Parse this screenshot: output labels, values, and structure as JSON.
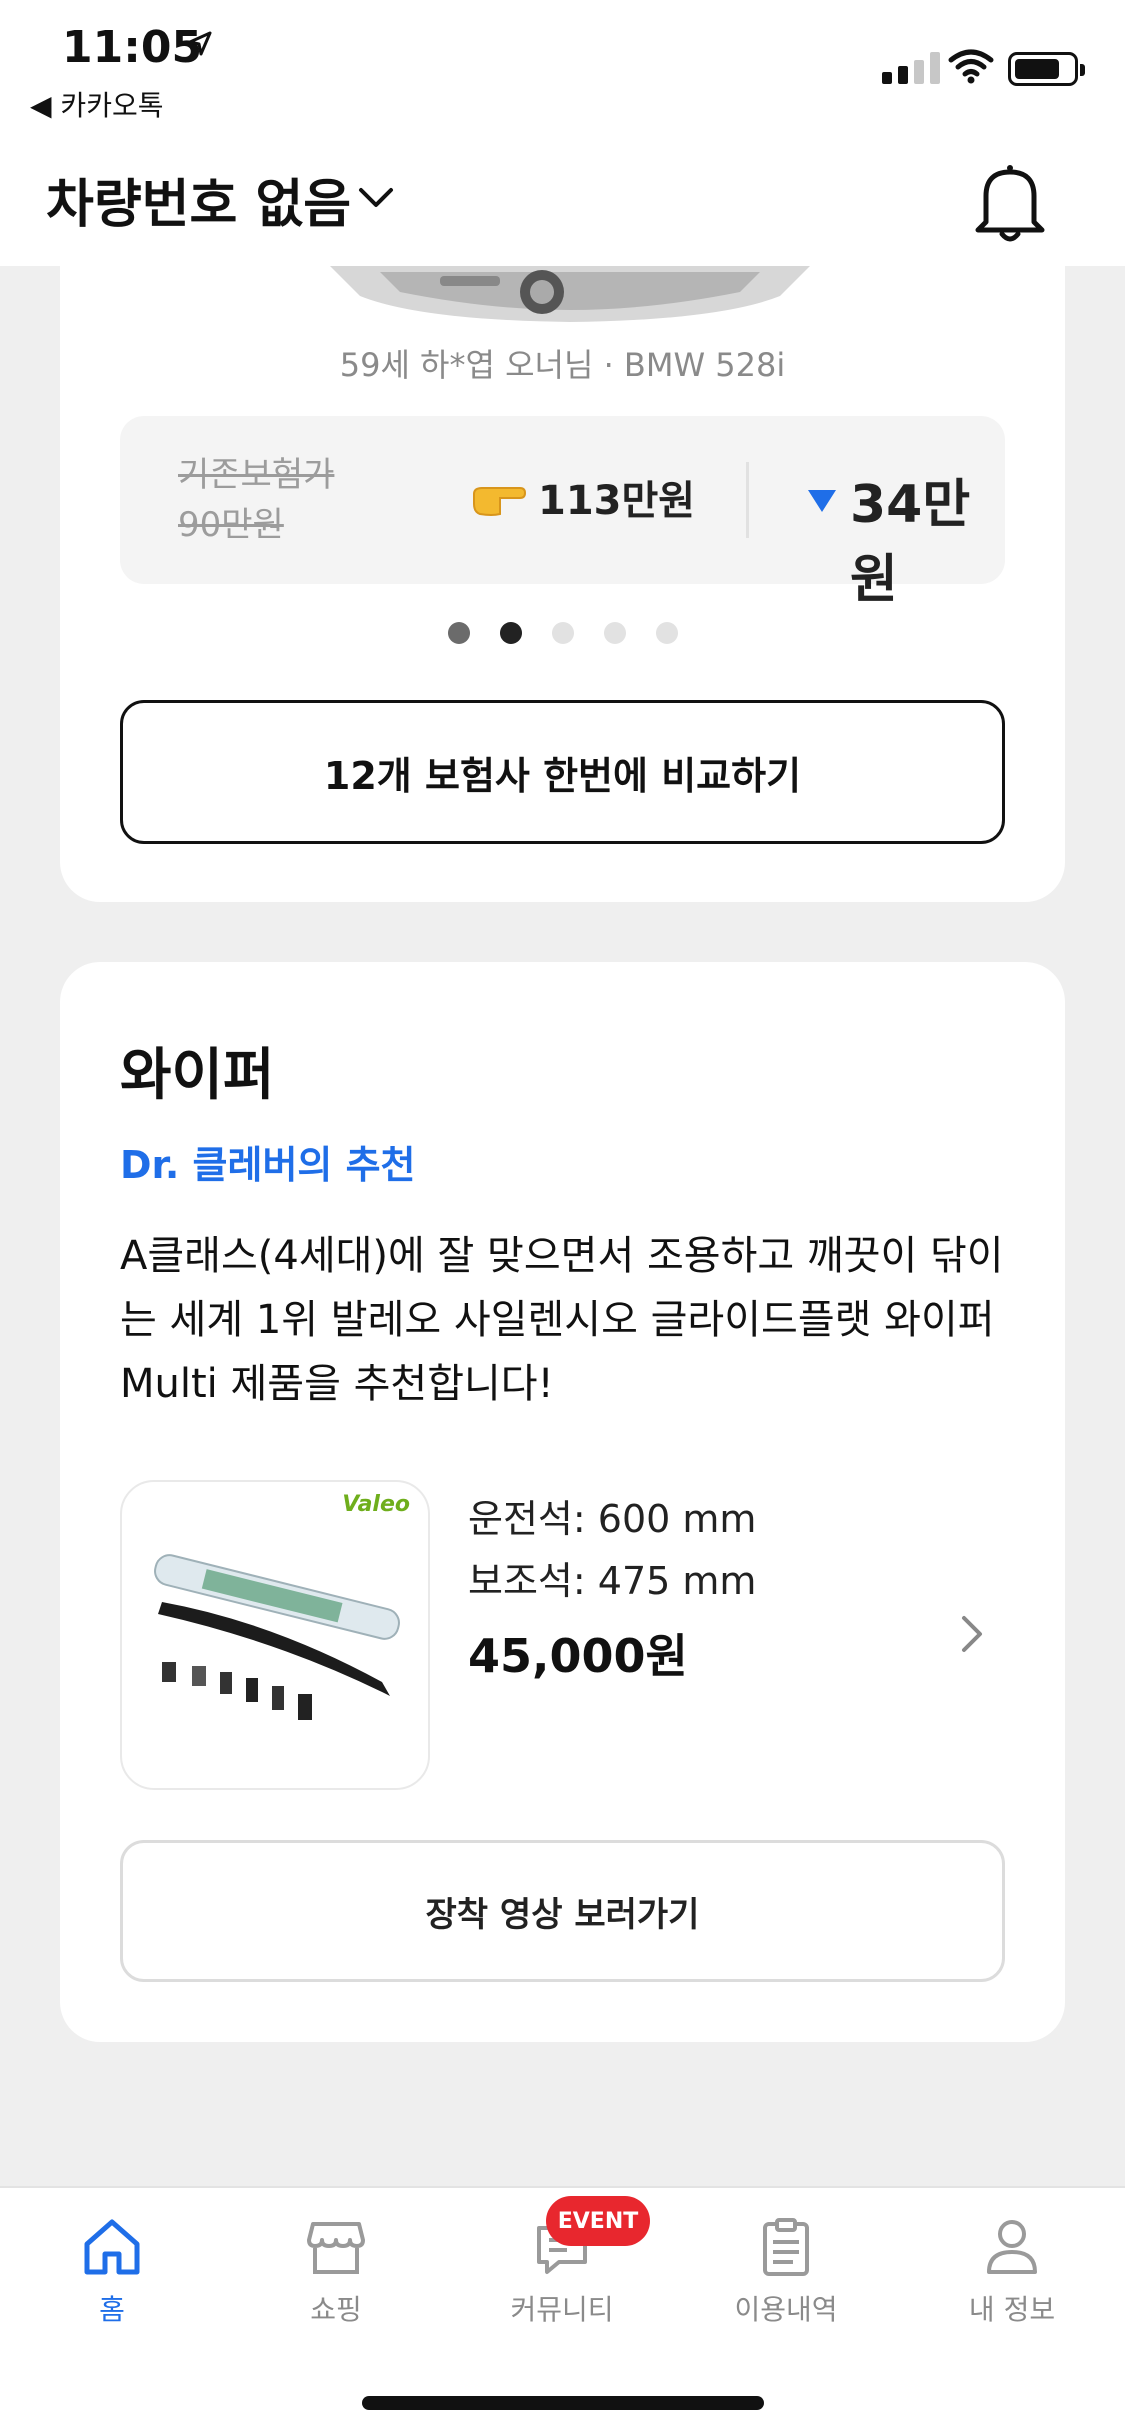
{
  "status_bar": {
    "time": "11:05",
    "back_app": "◀ 카카오톡"
  },
  "header": {
    "vehicle_title": "차량번호 없음"
  },
  "insurance_card": {
    "owner_caption": "59세 하*엽 오너님 · BMW 528i",
    "old_price": "기존보험가 90만원",
    "new_price": "113만원",
    "saving": "34만원",
    "carousel_pages": 5,
    "carousel_current": 2,
    "compare_button": "12개 보험사 한번에 비교하기"
  },
  "wiper_card": {
    "title": "와이퍼",
    "doctor_pick": "Dr. 클레버의 추천",
    "description": "A클래스(4세대)에 잘 맞으면서 조용하고 깨끗이 닦이는 세계 1위 발레오 사일렌시오 글라이드플랫 와이퍼 Multi 제품을 추천합니다!",
    "brand": "Valeo",
    "driver_spec": "운전석: 600 mm",
    "passenger_spec": "보조석: 475 mm",
    "price": "45,000원",
    "video_button": "장착 영상 보러가기"
  },
  "tab_bar": {
    "tabs": [
      {
        "label": "홈",
        "icon": "home-icon",
        "active": true
      },
      {
        "label": "쇼핑",
        "icon": "store-icon",
        "active": false
      },
      {
        "label": "커뮤니티",
        "icon": "chat-icon",
        "active": false
      },
      {
        "label": "이용내역",
        "icon": "clipboard-icon",
        "active": false
      },
      {
        "label": "내 정보",
        "icon": "person-icon",
        "active": false
      }
    ],
    "event_badge": "EVENT"
  },
  "colors": {
    "accent": "#1f6ee8",
    "badge": "#e8272e",
    "background": "#efefef"
  }
}
